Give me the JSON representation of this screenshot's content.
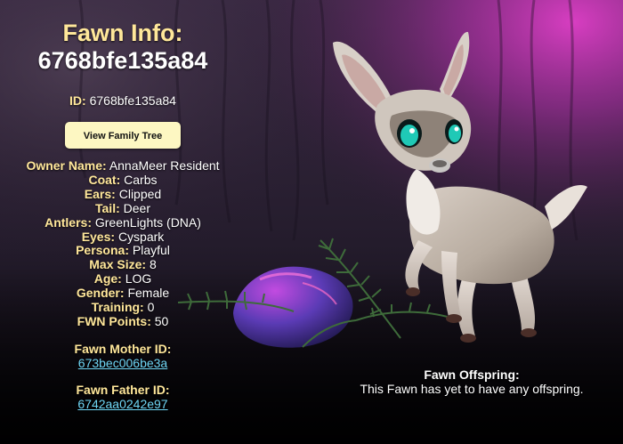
{
  "header": {
    "title": "Fawn Info:",
    "fawn_id": "6768bfe135a84"
  },
  "id_line": {
    "label": "ID:",
    "value": "6768bfe135a84"
  },
  "family_tree_button": "View Family Tree",
  "attributes": [
    {
      "label": "Owner Name:",
      "value": "AnnaMeer Resident"
    },
    {
      "label": "Coat:",
      "value": "Carbs"
    },
    {
      "label": "Ears:",
      "value": "Clipped"
    },
    {
      "label": "Tail:",
      "value": "Deer"
    },
    {
      "label": "Antlers:",
      "value": "GreenLights (DNA)"
    },
    {
      "label": "Eyes:",
      "value": "Cyspark"
    },
    {
      "label": "Persona:",
      "value": "Playful"
    },
    {
      "label": "Max Size:",
      "value": "8"
    },
    {
      "label": "Age:",
      "value": "LOG"
    },
    {
      "label": "Gender:",
      "value": "Female"
    },
    {
      "label": "Training:",
      "value": "0"
    },
    {
      "label": "FWN Points:",
      "value": "50"
    }
  ],
  "mother": {
    "label": "Fawn Mother ID:",
    "value": "673bec006be3a"
  },
  "father": {
    "label": "Fawn Father ID:",
    "value": "6742aa0242e97"
  },
  "offspring": {
    "title": "Fawn Offspring:",
    "message": "This Fawn has yet to have any offspring."
  },
  "colors": {
    "label_accent": "#ffe79a",
    "link": "#6fd6f5",
    "button_bg": "#fdf7c2",
    "background_top_right": "#a0309a",
    "background_dark": "#0b0a10"
  }
}
